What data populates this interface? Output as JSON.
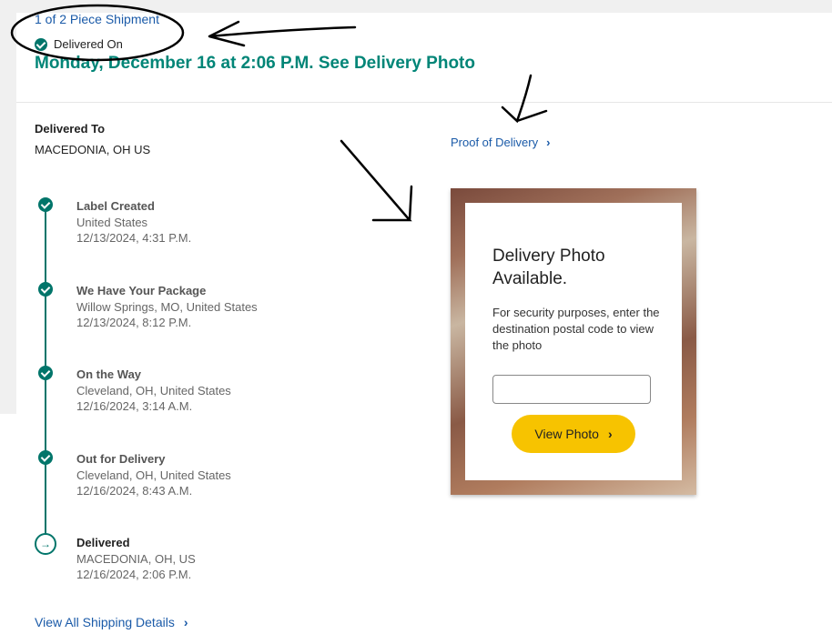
{
  "shipment": {
    "piece_link": "1 of 2 Piece Shipment",
    "delivered_on_label": "Delivered On",
    "delivered_date": "Monday, December 16 at 2:06 P.M. See Delivery Photo"
  },
  "delivered_to": {
    "label": "Delivered To",
    "value": "MACEDONIA, OH US"
  },
  "proof_of_delivery": {
    "label": "Proof of Delivery",
    "chevron": "›"
  },
  "events": [
    {
      "title": "Label Created",
      "location": "United States",
      "datetime": "12/13/2024, 4:31 P.M."
    },
    {
      "title": "We Have Your Package",
      "location": "Willow Springs, MO, United States",
      "datetime": "12/13/2024, 8:12 P.M."
    },
    {
      "title": "On the Way",
      "location": "Cleveland, OH, United States",
      "datetime": "12/16/2024, 3:14 A.M."
    },
    {
      "title": "Out for Delivery",
      "location": "Cleveland, OH, United States",
      "datetime": "12/16/2024, 8:43 A.M."
    },
    {
      "title": "Delivered",
      "location": "MACEDONIA, OH, US",
      "datetime": "12/16/2024, 2:06 P.M."
    }
  ],
  "view_all": {
    "label": "View All Shipping Details",
    "chevron": "›"
  },
  "photo": {
    "title": "Delivery Photo Available.",
    "description": "For security purposes, enter the destination postal code to view the photo",
    "input_value": "",
    "button_label": "View Photo",
    "button_chevron": "›"
  },
  "colors": {
    "teal": "#008577",
    "link": "#1a5aa8",
    "button": "#f7c300"
  },
  "icons": {
    "check": "check-circle-icon",
    "arrow": "arrow-right-circle-icon",
    "chevron": "chevron-right-icon"
  }
}
